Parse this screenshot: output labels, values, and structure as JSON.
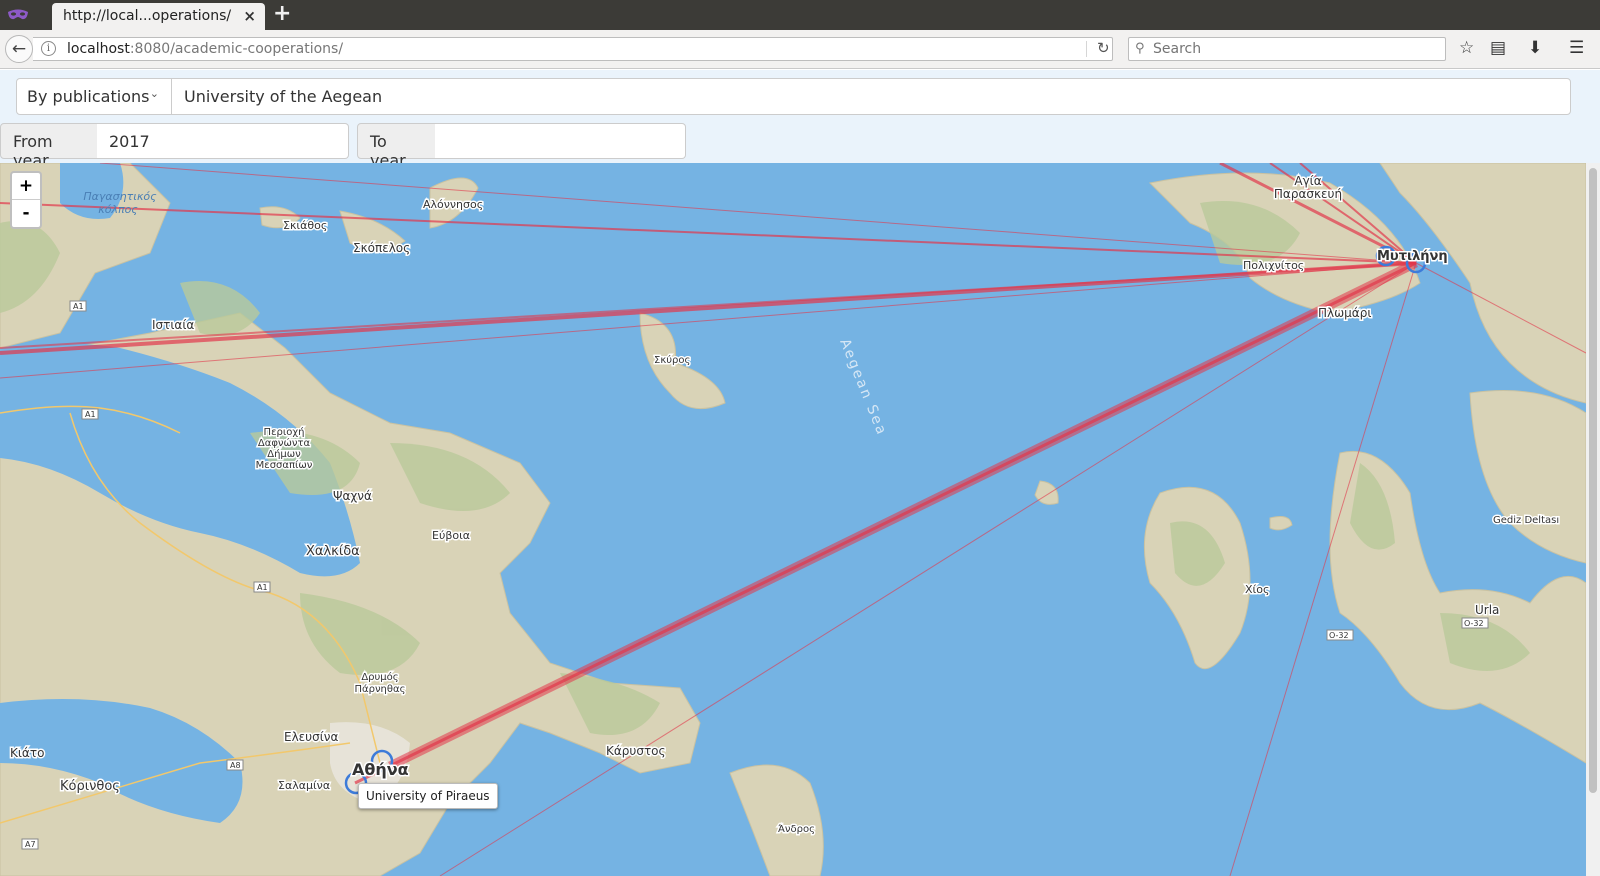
{
  "browser": {
    "tab_title": "http://local...operations/",
    "tab_close": "×",
    "new_tab": "+",
    "url_host": "localhost",
    "url_path": ":8080/academic-cooperations/",
    "search_placeholder": "Search"
  },
  "controls": {
    "mode_select": "By publications",
    "university_input": "University of the Aegean",
    "from_year_label": "From year",
    "from_year_value": "2017",
    "to_year_label": "To year",
    "to_year_value": ""
  },
  "map": {
    "zoom_in": "+",
    "zoom_out": "-",
    "tooltip": "University of Piraeus",
    "sea_label": "Aegean Sea",
    "places": [
      {
        "name": "Παγασητικός κόλπος"
      },
      {
        "name": "Σκιάθος"
      },
      {
        "name": "Αλόννησος"
      },
      {
        "name": "Σκόπελος"
      },
      {
        "name": "Ιστιαία"
      },
      {
        "name": "Σκύρος"
      },
      {
        "name": "Περιοχή Δαφνώντα Δήμων Μεσσαπίων"
      },
      {
        "name": "Ψαχνά"
      },
      {
        "name": "Χαλκίδα"
      },
      {
        "name": "Εύβοια"
      },
      {
        "name": "Δρυμός Πάρνηθας"
      },
      {
        "name": "Ελευσίνα"
      },
      {
        "name": "Κιάτο"
      },
      {
        "name": "Κόρινθος"
      },
      {
        "name": "Σαλαμίνα"
      },
      {
        "name": "Αθήνα"
      },
      {
        "name": "Κάρυστος"
      },
      {
        "name": "Άνδρος"
      },
      {
        "name": "Αγία Παρασκευή"
      },
      {
        "name": "Πολιχνίτος"
      },
      {
        "name": "Μυτιλήνη"
      },
      {
        "name": "Πλωμάρι"
      },
      {
        "name": "Χίος"
      },
      {
        "name": "Gediz Deltası"
      },
      {
        "name": "Urla"
      }
    ],
    "roads": [
      "A1",
      "A1",
      "A1",
      "A8",
      "A7",
      "O-32",
      "O-32"
    ]
  }
}
